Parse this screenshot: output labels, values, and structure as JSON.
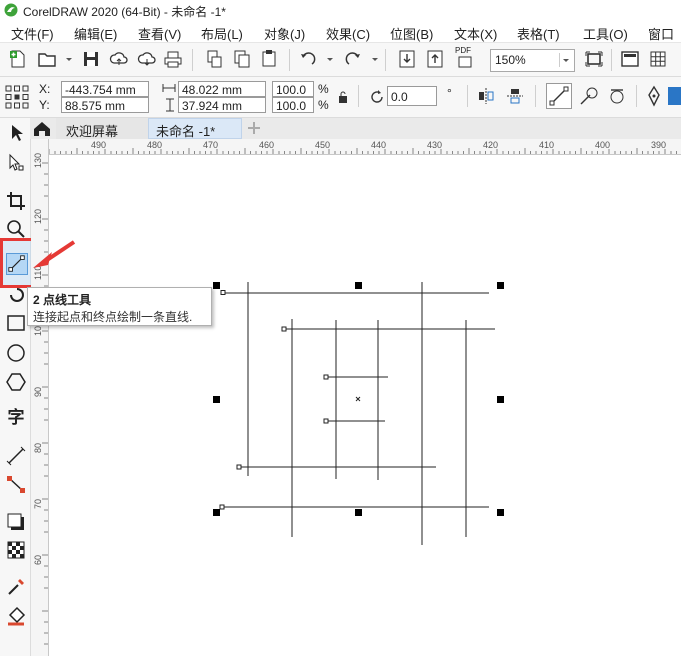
{
  "window": {
    "title": "CorelDRAW 2020 (64-Bit) - 未命名 -1*"
  },
  "menu": {
    "items": [
      "文件(F)",
      "编辑(E)",
      "查看(V)",
      "布局(L)",
      "对象(J)",
      "效果(C)",
      "位图(B)",
      "文本(X)",
      "表格(T)",
      "工具(O)",
      "窗口"
    ]
  },
  "toolbar": {
    "zoom": "150%",
    "pdf_label": "PDF"
  },
  "properties": {
    "x_label": "X:",
    "y_label": "Y:",
    "x_value": "-443.754 mm",
    "y_value": "88.575 mm",
    "width_value": "48.022 mm",
    "height_value": "37.924 mm",
    "scale_x": "100.0",
    "scale_y": "100.0",
    "percent": "%",
    "rotation": "0.0",
    "degree": "°"
  },
  "tabs": {
    "welcome": "欢迎屏幕",
    "document": "未命名 -1*"
  },
  "rulers": {
    "horizontal": [
      "490",
      "480",
      "470",
      "460",
      "450",
      "440",
      "430",
      "420",
      "410",
      "400",
      "390"
    ],
    "vertical": [
      "130",
      "120",
      "110",
      "100",
      "90",
      "80",
      "70",
      "60"
    ]
  },
  "tooltip": {
    "title": "2 点线工具",
    "description": "连接起点和终点绘制一条直线."
  },
  "toolbox": {
    "text_tool_glyph": "字"
  },
  "colors": {
    "highlight": "#e53935",
    "arrow": "#e53935",
    "selected_tool_bg": "#b4d7f5"
  }
}
